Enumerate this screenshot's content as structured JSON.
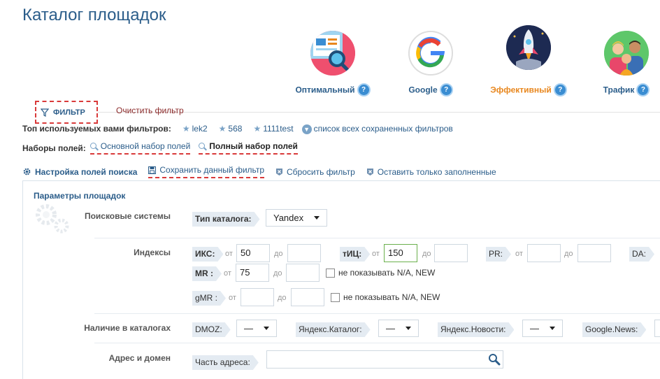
{
  "page": {
    "title": "Каталог площадок"
  },
  "categories": [
    {
      "label": "Оптимальный",
      "icon": "analytics-icon",
      "color": "#2b5d8a"
    },
    {
      "label": "Google",
      "icon": "google-logo-icon",
      "color": "#2b5d8a"
    },
    {
      "label": "Эффективный",
      "icon": "rocket-icon",
      "color": "#e8871e"
    },
    {
      "label": "Трафик",
      "icon": "people-icon",
      "color": "#2b5d8a"
    }
  ],
  "filter": {
    "tab_label": "ФИЛЬТР",
    "clear_label": "Очистить фильтр",
    "top_filters_label": "Топ используемых вами фильтров:",
    "top_filters": [
      "lek2",
      "568",
      "1111test"
    ],
    "all_saved_label": "список всех сохраненных фильтров",
    "field_sets_label": "Наборы полей:",
    "field_sets": [
      "Основной набор полей",
      "Полный набор полей"
    ]
  },
  "toolbar": {
    "settings": "Настройка полей поиска",
    "save": "Сохранить данный фильтр",
    "reset": "Сбросить фильтр",
    "keep_filled": "Оставить только заполненные"
  },
  "params": {
    "title": "Параметры площадок",
    "search_engines": {
      "label": "Поисковые системы",
      "catalog_type_label": "Тип каталога:",
      "catalog_type_value": "Yandex"
    },
    "indexes": {
      "label": "Индексы",
      "from": "от",
      "to": "до",
      "iks": {
        "label": "ИКС:",
        "from": "50",
        "to": ""
      },
      "tic": {
        "label": "тИЦ:",
        "from": "150",
        "to": ""
      },
      "pr": {
        "label": "PR:",
        "from": "",
        "to": ""
      },
      "da": {
        "label": "DA:"
      },
      "mr": {
        "label": "MR :",
        "from": "75",
        "to": ""
      },
      "gmr": {
        "label": "gMR :",
        "from": "",
        "to": ""
      },
      "hide_na": "не показывать N/A, NEW"
    },
    "catalogs": {
      "label": "Наличие в каталогах",
      "dmoz": {
        "label": "DMOZ:",
        "value": "—"
      },
      "yandex_catalog": {
        "label": "Яндекс.Каталог:",
        "value": "—"
      },
      "yandex_news": {
        "label": "Яндекс.Новости:",
        "value": "—"
      },
      "google_news": {
        "label": "Google.News:"
      }
    },
    "address": {
      "label": "Адрес и домен",
      "part_label": "Часть адреса:",
      "value": ""
    }
  }
}
